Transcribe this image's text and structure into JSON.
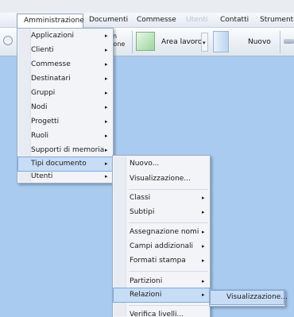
{
  "menubar": {
    "items": [
      {
        "label": "Amministrazione"
      },
      {
        "label": "Documenti"
      },
      {
        "label": "Commesse"
      },
      {
        "label": "Utenti"
      },
      {
        "label": "Contatti"
      },
      {
        "label": "Strumenti"
      }
    ]
  },
  "toolbar": {
    "partial_label_line1": "n",
    "partial_label_line2": "zione",
    "area_lavoro_label": "Area lavoro",
    "dropdown_arrow": "▾",
    "nuovo_label": "Nuovo"
  },
  "admin_menu": {
    "items": [
      {
        "label": "Applicazioni",
        "has_submenu": true
      },
      {
        "label": "Clienti",
        "has_submenu": true
      },
      {
        "label": "Commesse",
        "has_submenu": true
      },
      {
        "label": "Destinatari",
        "has_submenu": true
      },
      {
        "label": "Gruppi",
        "has_submenu": true
      },
      {
        "label": "Nodi",
        "has_submenu": true
      },
      {
        "label": "Progetti",
        "has_submenu": true
      },
      {
        "label": "Ruoli",
        "has_submenu": true
      },
      {
        "label": "Supporti di memoria",
        "has_submenu": true
      },
      {
        "label": "Tipi documento",
        "has_submenu": true
      },
      {
        "label": "Utenti",
        "has_submenu": true
      }
    ]
  },
  "tipi_documento_menu": {
    "items": [
      {
        "label": "Nuovo...",
        "has_submenu": false
      },
      {
        "label": "Visualizzazione...",
        "has_submenu": false
      },
      {
        "label": "Classi",
        "has_submenu": true
      },
      {
        "label": "Subtipi",
        "has_submenu": true
      },
      {
        "label": "Assegnazione nomi",
        "has_submenu": true
      },
      {
        "label": "Campi addizionali",
        "has_submenu": true
      },
      {
        "label": "Formati stampa",
        "has_submenu": true
      },
      {
        "label": "Partizioni",
        "has_submenu": true
      },
      {
        "label": "Relazioni",
        "has_submenu": true
      },
      {
        "label": "Verifica livelli...",
        "has_submenu": false
      }
    ]
  },
  "relazioni_menu": {
    "items": [
      {
        "label": "Visualizzazione..."
      }
    ]
  },
  "arrow_glyph": "▸",
  "icons": [
    "toolbar-circle-icon",
    "area-lavoro-icon",
    "dropdown-arrow-icon",
    "document-new-icon",
    "toolbar-overflow-icon",
    "submenu-arrow-icon"
  ],
  "colors": {
    "desktop_background": "#a9cbef",
    "menu_background": "#f2f4f7",
    "highlight": "#c7ddf6",
    "highlight_border": "#7ea9dd",
    "disabled_text": "#b8c0cb"
  }
}
